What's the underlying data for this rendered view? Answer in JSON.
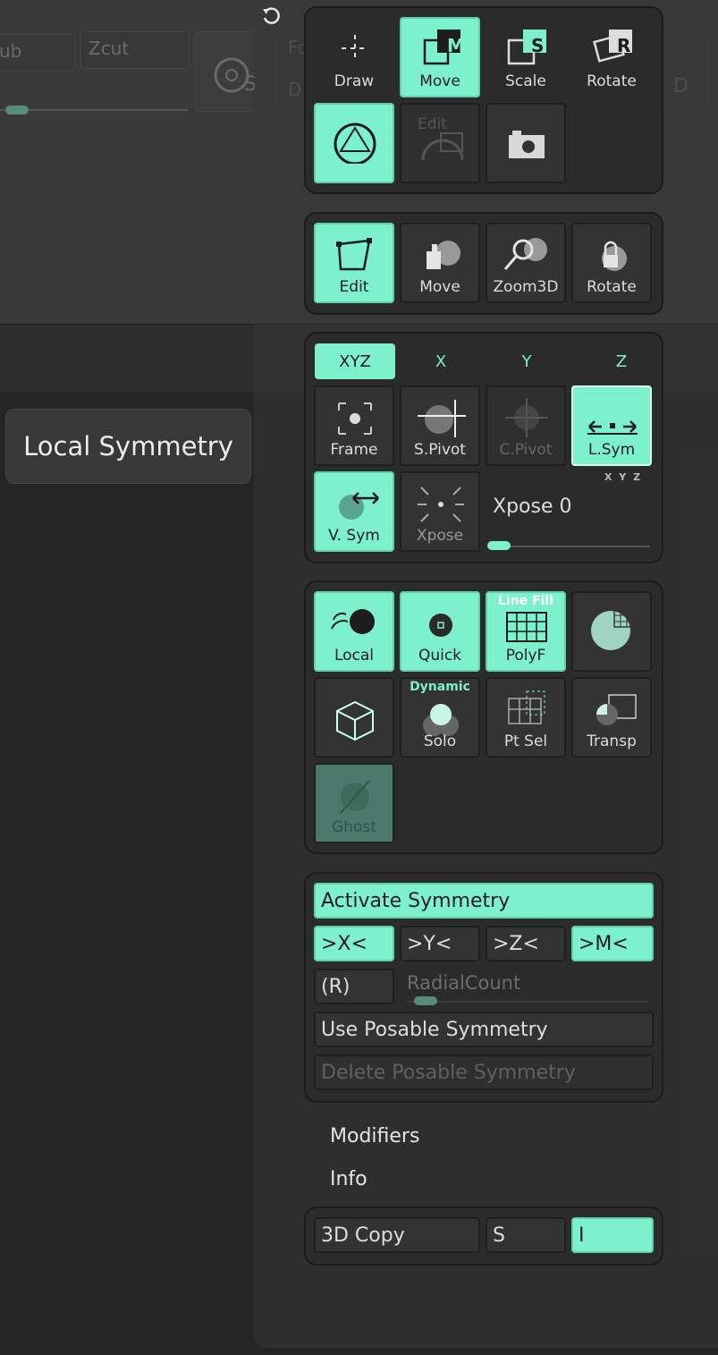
{
  "colors": {
    "accent": "#7df0cc",
    "panel": "#2b2b2b",
    "text": "#dcdcdc"
  },
  "background": {
    "field_left": "ub",
    "field_zcut": "Zcut",
    "field_fo": "Fo",
    "field_d": "D",
    "label_s": "S",
    "label_d": "D"
  },
  "tooltip": {
    "text": "Local Symmetry"
  },
  "transform_tools": {
    "draw": "Draw",
    "move": "Move",
    "scale": "Scale",
    "rotate": "Rotate",
    "move_key": "M",
    "scale_key": "S",
    "rotate_key": "R",
    "edit_label": "Edit"
  },
  "camera_tools": {
    "edit": "Edit",
    "move": "Move",
    "zoom3d": "Zoom3D",
    "rotate": "Rotate"
  },
  "axes": {
    "xyz": "XYZ",
    "x": "X",
    "y": "Y",
    "z": "Z",
    "sym_axes": "X Y Z"
  },
  "pivot_tools": {
    "frame": "Frame",
    "spivot": "S.Pivot",
    "cpivot": "C.Pivot",
    "lsym": "L.Sym",
    "vsym": "V. Sym",
    "xpose": "Xpose",
    "xpose_value": "Xpose 0",
    "xpose_slider_fraction": 0.05
  },
  "display_tools": {
    "local": "Local",
    "quick": "Quick",
    "linefill": "Line Fill",
    "polyf": "PolyF",
    "dynamic": "Dynamic",
    "solo": "Solo",
    "ptsel": "Pt Sel",
    "transp": "Transp",
    "ghost": "Ghost"
  },
  "symmetry": {
    "activate": "Activate Symmetry",
    "x": ">X<",
    "y": ">Y<",
    "z": ">Z<",
    "m": ">M<",
    "r": "(R)",
    "radial_label": "RadialCount",
    "radial_slider_fraction": 0.1,
    "use_posable": "Use Posable Symmetry",
    "delete_posable": "Delete Posable Symmetry"
  },
  "menu": {
    "modifiers": "Modifiers",
    "info": "Info"
  },
  "copy_row": {
    "copy": "3D Copy",
    "s": "S",
    "i": "I"
  }
}
